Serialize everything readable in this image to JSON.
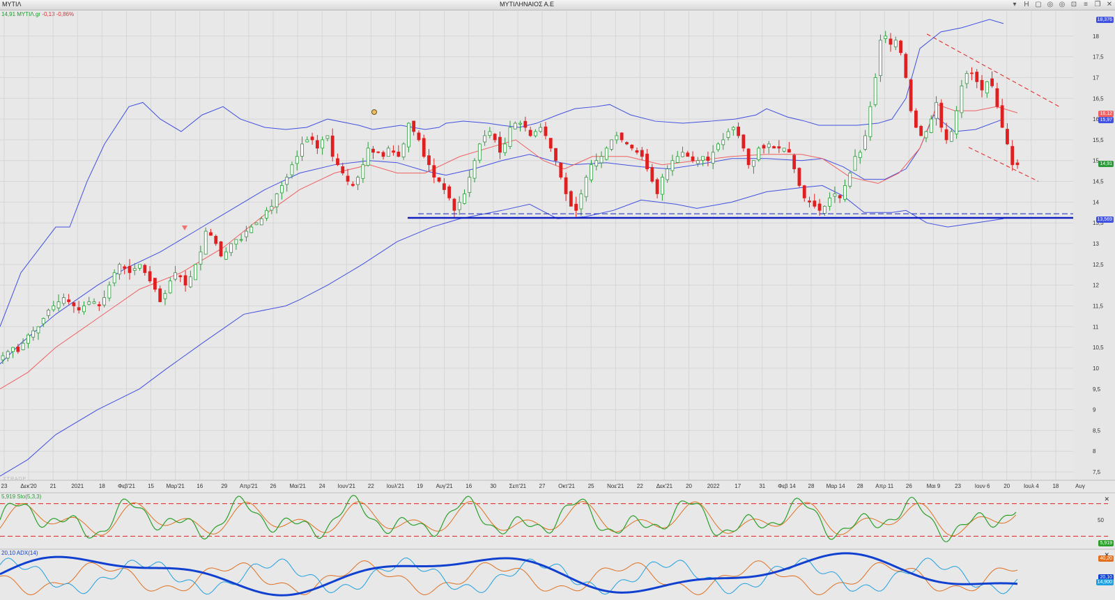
{
  "window": {
    "symbol_tab": "ΜΥΤΙΛ",
    "title": "ΜΥΤΙΛΗΝΑΙΟΣ Α.Ε",
    "tool_icons": [
      "chevron-down-icon",
      "h-icon",
      "chart-icon",
      "signal-icon",
      "link-icon",
      "lock-icon",
      "menu-icon",
      "restore-icon",
      "close-icon"
    ],
    "tool_glyphs": [
      "▾",
      "H",
      "▢",
      "◎",
      "◎",
      "⊡",
      "≡",
      "❐",
      "✕"
    ]
  },
  "quote": {
    "last": "14,91",
    "ticker": "ΜΥΤΙΛ.gr",
    "change": "-0,13",
    "change_pct": "-0,86%"
  },
  "watermark": "XTRADE",
  "colors": {
    "up": "#2a9a3a",
    "down": "#e02020",
    "bb": "#4050e0",
    "ema": "#f06060",
    "support": "#1020c0",
    "stoch_k": "#2aa02a",
    "stoch_d": "#e07020",
    "adx": "#1040d0",
    "diplus": "#20a0e0",
    "diminus": "#e07020"
  },
  "chart_data": [
    {
      "type": "candlestick",
      "price_range": [
        7.3,
        18.6
      ],
      "y_ticks": [
        "18",
        "17,5",
        "17",
        "16,5",
        "16",
        "15,5",
        "15",
        "14,5",
        "14",
        "13,5",
        "13",
        "12,5",
        "12",
        "11,5",
        "11",
        "10,5",
        "10",
        "9,5",
        "9",
        "8,5",
        "8",
        "7,5"
      ],
      "x_ticks": [
        "23",
        "Δεκ'20",
        "21",
        "2021",
        "18",
        "Φεβ'21",
        "15",
        "Μαρ'21",
        "16",
        "29",
        "Απρ'21",
        "26",
        "Μαι'21",
        "24",
        "Ιουν'21",
        "22",
        "Ιουλ'21",
        "19",
        "Αυγ'21",
        "16",
        "30",
        "Σεπ'21",
        "27",
        "Οκτ'21",
        "25",
        "Νοε'21",
        "22",
        "Δεκ'21",
        "20",
        "2022",
        "17",
        "31",
        "Φεβ 14",
        "28",
        "Μαρ 14",
        "28",
        "Απρ 11",
        "26",
        "Μαι 9",
        "23",
        "Ιουν 6",
        "20",
        "Ιουλ 4",
        "18",
        "Αυγ"
      ],
      "closes": [
        10.3,
        10.4,
        10.5,
        10.4,
        10.6,
        10.8,
        10.9,
        11.0,
        11.2,
        11.4,
        11.5,
        11.6,
        11.7,
        11.6,
        11.5,
        11.4,
        11.5,
        11.6,
        11.6,
        11.5,
        11.7,
        12.0,
        12.3,
        12.5,
        12.4,
        12.3,
        12.4,
        12.5,
        12.3,
        12.1,
        11.9,
        11.6,
        11.8,
        12.1,
        12.3,
        12.2,
        12.0,
        12.2,
        12.5,
        12.8,
        13.3,
        13.2,
        13.0,
        12.7,
        12.8,
        13.0,
        13.1,
        13.1,
        13.3,
        13.4,
        13.5,
        13.6,
        13.8,
        13.9,
        14.2,
        14.4,
        14.6,
        14.9,
        15.1,
        15.4,
        15.5,
        15.5,
        15.3,
        15.5,
        15.6,
        15.1,
        14.9,
        14.7,
        14.5,
        14.4,
        14.6,
        14.9,
        15.3,
        15.2,
        15.2,
        15.1,
        15.3,
        15.2,
        15.1,
        15.4,
        15.9,
        15.7,
        15.5,
        15.1,
        14.9,
        14.6,
        14.5,
        14.3,
        14.1,
        13.8,
        14.0,
        14.2,
        14.6,
        15.0,
        15.4,
        15.6,
        15.7,
        15.5,
        15.2,
        15.4,
        15.8,
        15.9,
        15.9,
        15.8,
        15.6,
        15.7,
        15.8,
        15.6,
        15.3,
        15.0,
        14.6,
        14.2,
        13.9,
        13.8,
        14.2,
        14.6,
        14.9,
        15.0,
        15.1,
        15.3,
        15.5,
        15.6,
        15.5,
        15.4,
        15.3,
        15.2,
        15.1,
        14.8,
        14.5,
        14.2,
        14.6,
        14.8,
        15.0,
        15.1,
        15.2,
        15.1,
        15.0,
        15.0,
        15.1,
        15.0,
        15.2,
        15.4,
        15.5,
        15.7,
        15.8,
        15.6,
        15.3,
        14.9,
        15.0,
        15.3,
        15.3,
        15.4,
        15.3,
        15.3,
        15.3,
        15.2,
        14.8,
        14.4,
        14.1,
        14.0,
        13.9,
        13.8,
        13.9,
        14.1,
        14.2,
        14.1,
        14.4,
        14.7,
        15.1,
        15.2,
        15.6,
        16.3,
        17.0,
        17.9,
        18.0,
        17.8,
        17.9,
        17.6,
        17.0,
        16.2,
        15.8,
        15.6,
        15.7,
        16.0,
        16.4,
        15.8,
        15.5,
        15.7,
        16.2,
        16.8,
        17.1,
        17.1,
        16.9,
        16.7,
        16.9,
        16.8,
        16.3,
        15.8,
        15.4,
        14.9,
        14.9
      ],
      "bollinger_upper": [
        [
          0,
          11.0
        ],
        [
          30,
          12.3
        ],
        [
          80,
          13.4
        ],
        [
          100,
          13.4
        ],
        [
          125,
          14.5
        ],
        [
          150,
          15.4
        ],
        [
          185,
          16.3
        ],
        [
          205,
          16.4
        ],
        [
          230,
          16.0
        ],
        [
          260,
          15.7
        ],
        [
          290,
          16.1
        ],
        [
          320,
          16.3
        ],
        [
          345,
          16.0
        ],
        [
          380,
          15.8
        ],
        [
          410,
          15.75
        ],
        [
          440,
          15.8
        ],
        [
          470,
          16.0
        ],
        [
          500,
          15.9
        ],
        [
          515,
          15.85
        ],
        [
          535,
          15.75
        ],
        [
          555,
          15.8
        ],
        [
          575,
          15.85
        ],
        [
          610,
          15.75
        ],
        [
          630,
          15.8
        ],
        [
          640,
          15.9
        ],
        [
          665,
          15.95
        ],
        [
          700,
          15.9
        ],
        [
          720,
          15.85
        ],
        [
          745,
          15.8
        ],
        [
          770,
          15.9
        ],
        [
          800,
          16.1
        ],
        [
          825,
          16.25
        ],
        [
          855,
          16.3
        ],
        [
          875,
          16.35
        ],
        [
          905,
          16.1
        ],
        [
          940,
          15.95
        ],
        [
          980,
          15.9
        ],
        [
          1020,
          15.95
        ],
        [
          1055,
          16.0
        ],
        [
          1085,
          16.1
        ],
        [
          1100,
          16.25
        ],
        [
          1130,
          16.05
        ],
        [
          1155,
          15.95
        ],
        [
          1175,
          15.85
        ],
        [
          1205,
          15.85
        ],
        [
          1230,
          15.85
        ],
        [
          1260,
          15.9
        ],
        [
          1280,
          16.0
        ],
        [
          1300,
          16.5
        ],
        [
          1320,
          17.7
        ],
        [
          1350,
          18.1
        ],
        [
          1380,
          18.2
        ],
        [
          1420,
          18.4
        ],
        [
          1440,
          18.3
        ]
      ],
      "bollinger_middle": [
        [
          0,
          10.1
        ],
        [
          30,
          10.6
        ],
        [
          80,
          11.3
        ],
        [
          140,
          12.0
        ],
        [
          180,
          12.4
        ],
        [
          230,
          12.8
        ],
        [
          280,
          13.3
        ],
        [
          330,
          13.8
        ],
        [
          380,
          14.3
        ],
        [
          430,
          14.7
        ],
        [
          480,
          14.9
        ],
        [
          530,
          15.0
        ],
        [
          570,
          14.95
        ],
        [
          610,
          14.75
        ],
        [
          640,
          14.65
        ],
        [
          680,
          14.8
        ],
        [
          720,
          15.0
        ],
        [
          760,
          15.15
        ],
        [
          790,
          15.0
        ],
        [
          820,
          14.9
        ],
        [
          870,
          14.95
        ],
        [
          920,
          14.85
        ],
        [
          960,
          14.8
        ],
        [
          1000,
          14.9
        ],
        [
          1050,
          15.05
        ],
        [
          1100,
          15.05
        ],
        [
          1150,
          15.0
        ],
        [
          1180,
          15.05
        ],
        [
          1210,
          14.85
        ],
        [
          1240,
          14.55
        ],
        [
          1270,
          14.55
        ],
        [
          1300,
          14.8
        ],
        [
          1320,
          15.3
        ],
        [
          1340,
          16.1
        ],
        [
          1370,
          15.7
        ],
        [
          1400,
          15.75
        ],
        [
          1440,
          16.0
        ]
      ],
      "bollinger_lower": [
        [
          0,
          7.4
        ],
        [
          40,
          7.8
        ],
        [
          80,
          8.4
        ],
        [
          140,
          9.0
        ],
        [
          200,
          9.5
        ],
        [
          240,
          10.0
        ],
        [
          290,
          10.6
        ],
        [
          350,
          11.3
        ],
        [
          410,
          11.5
        ],
        [
          430,
          11.65
        ],
        [
          470,
          12.0
        ],
        [
          520,
          12.5
        ],
        [
          570,
          13.05
        ],
        [
          620,
          13.4
        ],
        [
          660,
          13.6
        ],
        [
          720,
          13.8
        ],
        [
          760,
          13.95
        ],
        [
          800,
          13.6
        ],
        [
          840,
          13.65
        ],
        [
          880,
          13.8
        ],
        [
          920,
          14.05
        ],
        [
          970,
          13.95
        ],
        [
          1000,
          13.85
        ],
        [
          1050,
          14.0
        ],
        [
          1100,
          14.25
        ],
        [
          1150,
          14.35
        ],
        [
          1180,
          14.4
        ],
        [
          1210,
          14.15
        ],
        [
          1240,
          13.75
        ],
        [
          1280,
          13.75
        ],
        [
          1300,
          13.8
        ],
        [
          1330,
          13.5
        ],
        [
          1360,
          13.4
        ],
        [
          1400,
          13.5
        ],
        [
          1440,
          13.6
        ]
      ],
      "ema": [
        [
          0,
          9.5
        ],
        [
          40,
          9.9
        ],
        [
          80,
          10.5
        ],
        [
          140,
          11.2
        ],
        [
          200,
          11.9
        ],
        [
          260,
          12.3
        ],
        [
          320,
          12.9
        ],
        [
          380,
          13.7
        ],
        [
          430,
          14.3
        ],
        [
          480,
          14.7
        ],
        [
          530,
          14.9
        ],
        [
          570,
          14.7
        ],
        [
          610,
          14.7
        ],
        [
          660,
          15.1
        ],
        [
          700,
          15.3
        ],
        [
          740,
          15.5
        ],
        [
          780,
          15.0
        ],
        [
          810,
          14.8
        ],
        [
          850,
          15.1
        ],
        [
          900,
          15.1
        ],
        [
          950,
          14.9
        ],
        [
          1000,
          15.0
        ],
        [
          1050,
          15.1
        ],
        [
          1100,
          15.15
        ],
        [
          1150,
          15.15
        ],
        [
          1180,
          15.05
        ],
        [
          1220,
          14.6
        ],
        [
          1260,
          14.45
        ],
        [
          1290,
          14.7
        ],
        [
          1320,
          15.3
        ],
        [
          1345,
          16.35
        ],
        [
          1370,
          16.2
        ],
        [
          1400,
          16.2
        ],
        [
          1430,
          16.3
        ],
        [
          1460,
          16.15
        ]
      ],
      "support_line": 13.62,
      "dashed_support": 13.72,
      "resistance_dashed": [
        [
          1330,
          18.05
        ],
        [
          1520,
          16.3
        ]
      ],
      "lower_channel_dashed": [
        [
          1390,
          15.32
        ],
        [
          1490,
          14.5
        ]
      ],
      "right_labels": [
        {
          "text": "18,376",
          "value": 18.376,
          "color": "#4050e0"
        },
        {
          "text": "16,12",
          "value": 16.12,
          "color": "#f06060"
        },
        {
          "text": "15,97",
          "value": 15.97,
          "color": "#4050e0"
        },
        {
          "text": "14,91",
          "value": 14.91,
          "color": "#2a9a3a"
        },
        {
          "text": "13,569",
          "value": 13.569,
          "color": "#4050e0"
        }
      ]
    },
    {
      "type": "line",
      "label": "5,919 Sto(5,3,3)",
      "y_range": [
        0,
        100
      ],
      "y_ticks": [
        "50"
      ],
      "upper_level": 80,
      "lower_level": 20,
      "last": "5,919"
    },
    {
      "type": "line",
      "label": "20,10 ADX(14)",
      "y_range": [
        0,
        50
      ],
      "values_labels": [
        "40,20",
        "20,10",
        "14,900"
      ],
      "values_colors": [
        "#e07020",
        "#1040d0",
        "#20a0e0"
      ]
    }
  ]
}
